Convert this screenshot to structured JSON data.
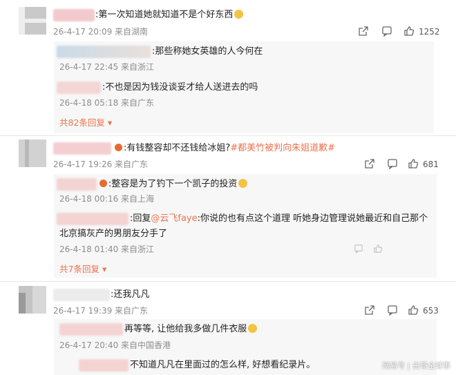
{
  "comments": [
    {
      "text": ":第一次知道她就知道不是个好东西",
      "meta": "26-4-17 20:09 来自湖南",
      "likes": "1252",
      "replies": [
        {
          "text": ":那些称她女英雄的人今何在",
          "meta": "26-4-17 22:45 来自浙江"
        },
        {
          "text": ":不也是因为钱没谈妥才给人送进去的吗",
          "meta": "26-4-18 05:18 来自广东"
        }
      ],
      "more": "共82条回复"
    },
    {
      "text": ":有钱整容却不还钱给冰姐?",
      "hashtag": "#都美竹被判向朱姐道歉#",
      "meta": "26-4-17 19:26 来自广东",
      "likes": "681",
      "replies": [
        {
          "text": "整容是为了钓下一个凯子的投资",
          "meta": "26-4-18 00:16 来自上海"
        },
        {
          "text_prefix": ":回复",
          "mention": "@云飞faye",
          "text_line1": ":你说的也有点这个道理  听她身边管理说她最近和自己那个",
          "text_line2": "北京搞灰产的男朋友分手了",
          "meta": "26-4-18 01:40 来自浙江"
        }
      ],
      "more": "共7条回复"
    },
    {
      "text": ":还我凡凡",
      "meta": "26-4-17 19:39 来自广东",
      "likes": "653",
      "replies": [
        {
          "text": "再等等, 让他给我多做几件衣服",
          "meta": "26-4-17 20:40 来自中国香港"
        },
        {
          "text": "不知道凡凡在里面过的怎么样, 好想看纪录片。"
        }
      ]
    }
  ],
  "watermark": "网易号 | 白哥全球事",
  "icons": {
    "share": "share-icon",
    "comment": "comment-icon",
    "like": "thumbs-up-icon",
    "more_arrow": "caret-down-icon"
  },
  "colors": {
    "accent": "#eb7350",
    "meta": "#8c8c8c",
    "reply_bg": "#f7f7f7"
  }
}
